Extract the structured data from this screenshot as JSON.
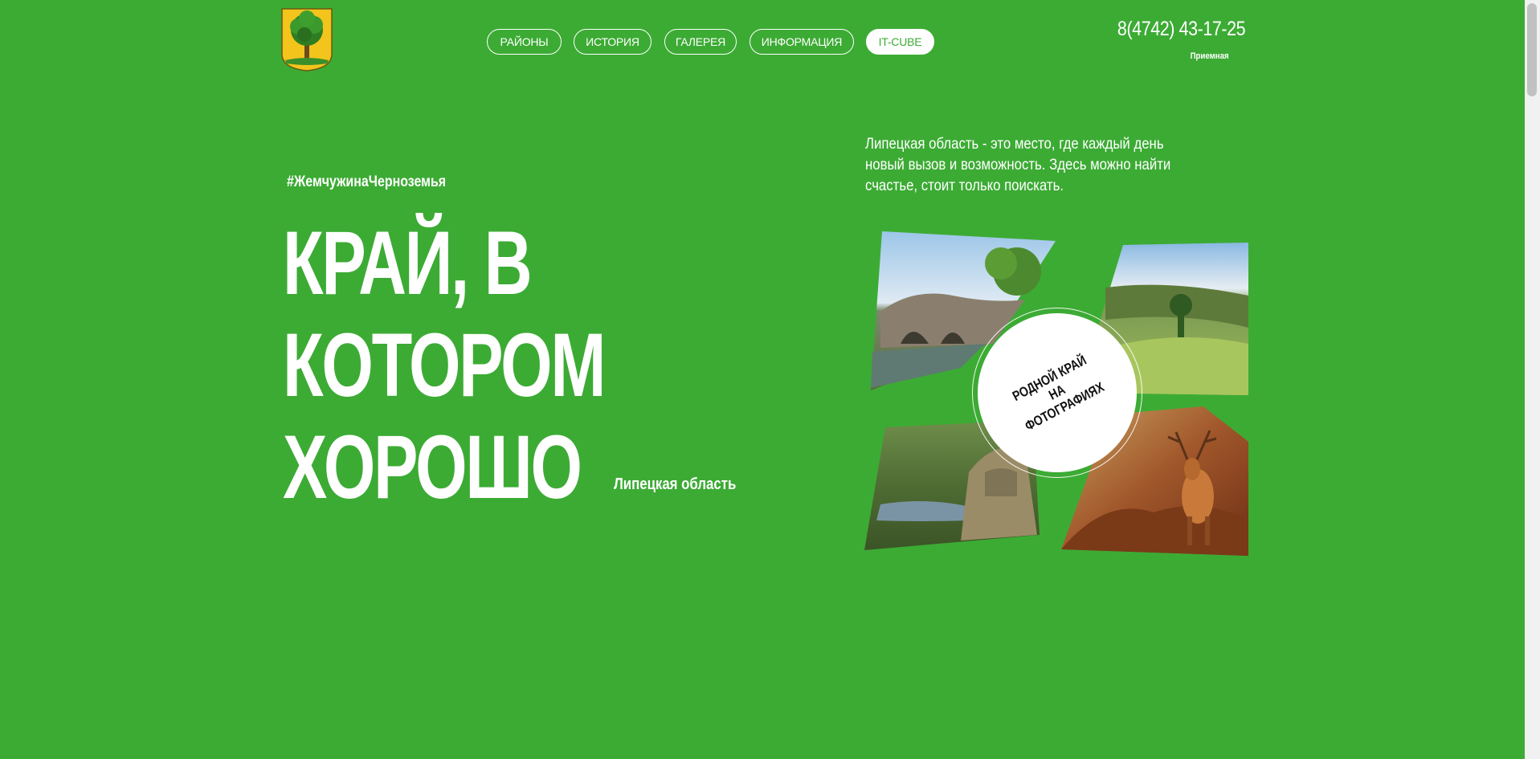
{
  "colors": {
    "background": "#3cab34",
    "text": "#ffffff",
    "accent": "#ffffff"
  },
  "header": {
    "logo_icon": "coat-of-arms-lipetsk",
    "nav": [
      {
        "label": "РАЙОНЫ",
        "active": false
      },
      {
        "label": "ИСТОРИЯ",
        "active": false
      },
      {
        "label": "ГАЛЕРЕЯ",
        "active": false
      },
      {
        "label": "ИНФОРМАЦИЯ",
        "active": false
      },
      {
        "label": "IT-CUBE",
        "active": true
      }
    ],
    "phone": "8(4742) 43-17-25",
    "phone_caption": "Приемная"
  },
  "hero": {
    "hashtag": "#ЖемчужинаЧерноземья",
    "title_lines": [
      "КРАЙ, В",
      "КОТОРОМ",
      "ХОРОШО"
    ],
    "region": "Липецкая область",
    "intro": "Липецкая область - это место, где каждый день новый вызов и возможность. Здесь можно найти счастье, стоит только поискать.",
    "gallery_button": "РОДНОЙ КРАЙ НА ФОТОГРАФИЯХ",
    "photos": [
      "bridge-photo",
      "valley-photo",
      "lake-rock-photo",
      "deer-photo"
    ]
  }
}
